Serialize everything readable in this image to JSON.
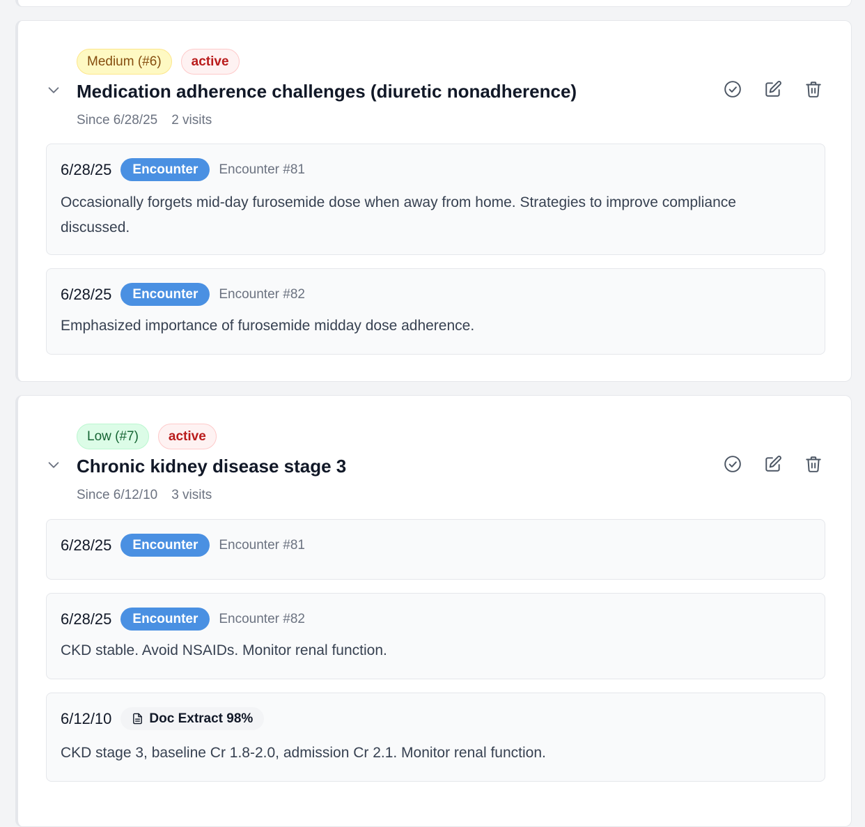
{
  "problems": [
    {
      "priority_label": "Medium (#6)",
      "status": "active",
      "title": "Medication adherence challenges (diuretic nonadherence)",
      "since": "Since 6/28/25",
      "visits": "2 visits",
      "entries": [
        {
          "date": "6/28/25",
          "source": "Encounter",
          "ref": "Encounter #81",
          "text": "Occasionally forgets mid-day furosemide dose when away from home. Strategies to improve compliance discussed."
        },
        {
          "date": "6/28/25",
          "source": "Encounter",
          "ref": "Encounter #82",
          "text": "Emphasized importance of furosemide midday dose adherence."
        }
      ]
    },
    {
      "priority_label": "Low (#7)",
      "status": "active",
      "title": "Chronic kidney disease stage 3",
      "since": "Since 6/12/10",
      "visits": "3 visits",
      "entries": [
        {
          "date": "6/28/25",
          "source": "Encounter",
          "ref": "Encounter #81",
          "text": ""
        },
        {
          "date": "6/28/25",
          "source": "Encounter",
          "ref": "Encounter #82",
          "text": "CKD stable. Avoid NSAIDs. Monitor renal function."
        },
        {
          "date": "6/12/10",
          "source": "Doc Extract 98%",
          "ref": "",
          "text": "CKD stage 3, baseline Cr 1.8-2.0, admission Cr 2.1. Monitor renal function."
        }
      ]
    }
  ],
  "icons": {
    "chevron": "chevron-down-icon",
    "resolve": "check-circle-icon",
    "edit": "edit-icon",
    "delete": "trash-icon",
    "document": "document-icon"
  },
  "colors": {
    "encounter_badge": "#4a90e2",
    "active_text": "#b91c1c",
    "medium_bg": "#fef9c3",
    "low_bg": "#dcfce7"
  }
}
